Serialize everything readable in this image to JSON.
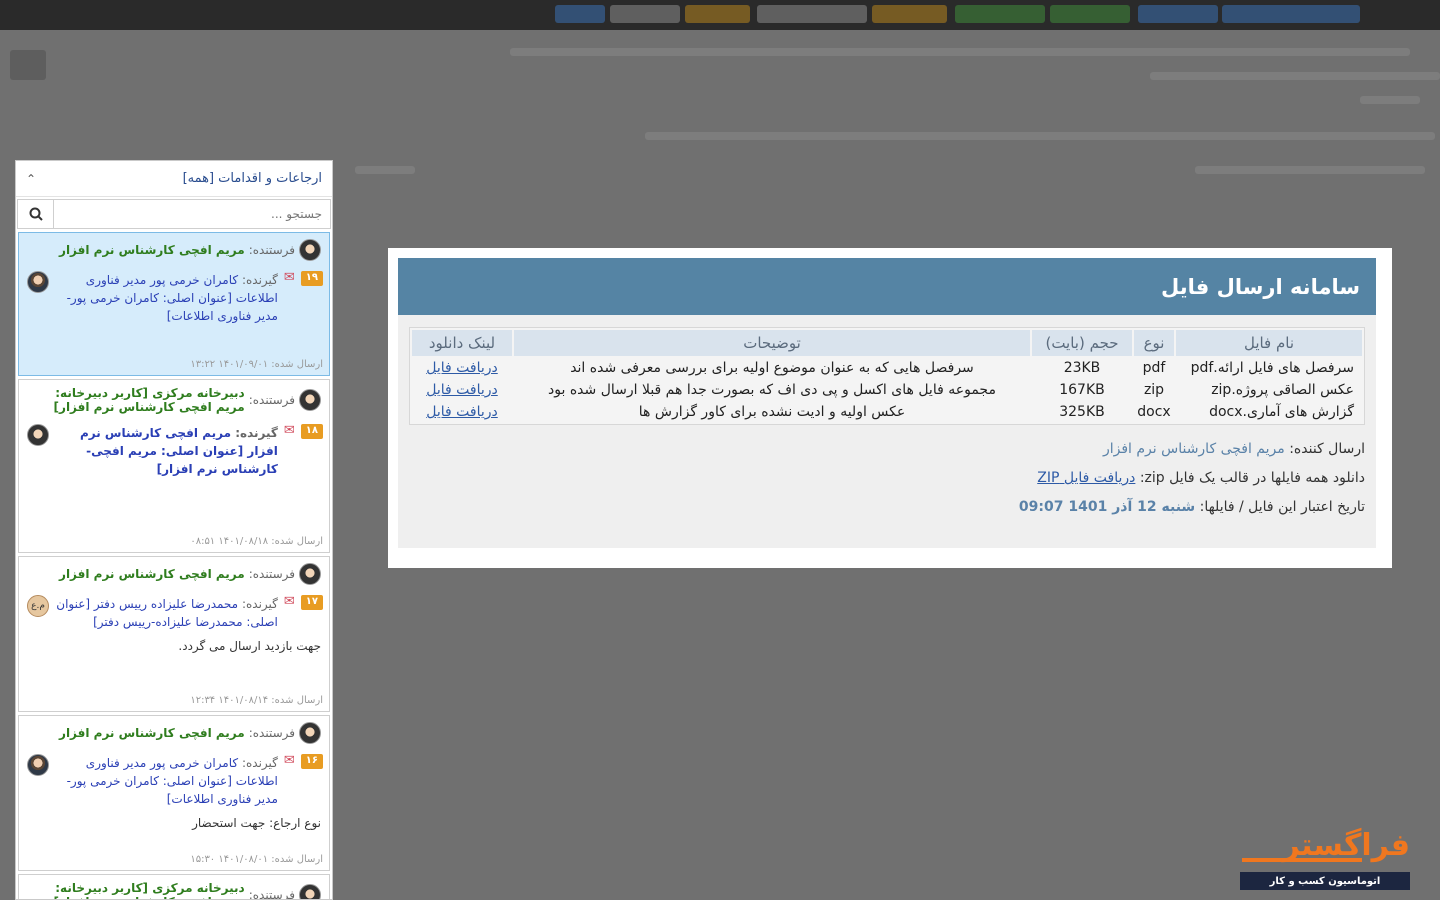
{
  "panel": {
    "title": "ارجاعات و اقدامات [همه]",
    "search_placeholder": "جستجو ...",
    "cards": [
      {
        "sender_label": "فرستنده:",
        "sender": "مریم افچی کارشناس نرم افزار",
        "number": "۱۹",
        "recipient_label": "گیرنده:",
        "recipient": "کامران خرمی پور مدیر فناوری اطلاعات [عنوان اصلی: کامران خرمی پور-مدیر فناوری اطلاعات]",
        "note": "",
        "sent": "ارسال شده: ۱۴۰۱/۰۹/۰۱ ۱۳:۲۲"
      },
      {
        "sender_label": "فرستنده:",
        "sender": "دبیرخانه مرکزی [کاربر دبیرخانه: مریم افچی کارشناس نرم افزار]",
        "number": "۱۸",
        "recipient_label": "گیرنده:",
        "recipient": "مریم افچی کارشناس نرم افزار [عنوان اصلی: مریم افچی-کارشناس نرم افزار]",
        "note": "",
        "sent": "ارسال شده: ۱۴۰۱/۰۸/۱۸ ۰۸:۵۱"
      },
      {
        "sender_label": "فرستنده:",
        "sender": "مریم افچی کارشناس نرم افزار",
        "number": "۱۷",
        "recipient_label": "گیرنده:",
        "recipient": "محمدرضا علیزاده رییس دفتر [عنوان اصلی: محمدرضا علیزاده-رییس دفتر]",
        "avatar_initials": "م.ع",
        "note": "جهت بازدید ارسال می گردد.",
        "sent": "ارسال شده: ۱۴۰۱/۰۸/۱۴ ۱۲:۳۴"
      },
      {
        "sender_label": "فرستنده:",
        "sender": "مریم افچی کارشناس نرم افزار",
        "number": "۱۶",
        "recipient_label": "گیرنده:",
        "recipient": "کامران خرمی پور مدیر فناوری اطلاعات [عنوان اصلی: کامران خرمی پور-مدیر فناوری اطلاعات]",
        "note": "نوع ارجاع: جهت استحضار",
        "sent": "ارسال شده: ۱۴۰۱/۰۸/۰۱ ۱۵:۳۰"
      },
      {
        "sender_label": "فرستنده:",
        "sender": "دبیرخانه مرکزی [کاربر دبیرخانه: مریم افچی کارشناس نرم افزار]"
      }
    ]
  },
  "modal": {
    "title": "سامانه ارسال فایل",
    "columns": [
      "نام فایل",
      "نوع",
      "حجم (بایت)",
      "توضیحات",
      "لینک دانلود"
    ],
    "rows": [
      {
        "name": "سرفصل های فایل ارائه.pdf",
        "type": "pdf",
        "size": "23KB",
        "desc": "سرفصل هایی که به عنوان موضوع اولیه برای بررسی معرفی شده اند",
        "link": "دریافت فایل"
      },
      {
        "name": "عکس الصاقی پروژه.zip",
        "type": "zip",
        "size": "167KB",
        "desc": "مجموعه فایل های اکسل و پی دی اف که بصورت جدا هم قبلا ارسال شده بود",
        "link": "دریافت فایل"
      },
      {
        "name": "گزارش های آماری.docx",
        "type": "docx",
        "size": "325KB",
        "desc": "عکس اولیه و ادیت نشده برای کاور گزارش ها",
        "link": "دریافت فایل"
      }
    ],
    "sender_label": "ارسال کننده:",
    "sender": "مریم افچی کارشناس نرم افزار",
    "zip_label": "دانلود همه فایلها در قالب یک فایل zip:",
    "zip_link": "دریافت فایل ZIP",
    "expiry_label": "تاریخ اعتبار این فایل / فایلها:",
    "expiry": "شنبه 12 آذر 1401 09:07"
  },
  "brand": {
    "name": "فراگستر",
    "tagline": "اتوماسیون کسب و کار"
  }
}
